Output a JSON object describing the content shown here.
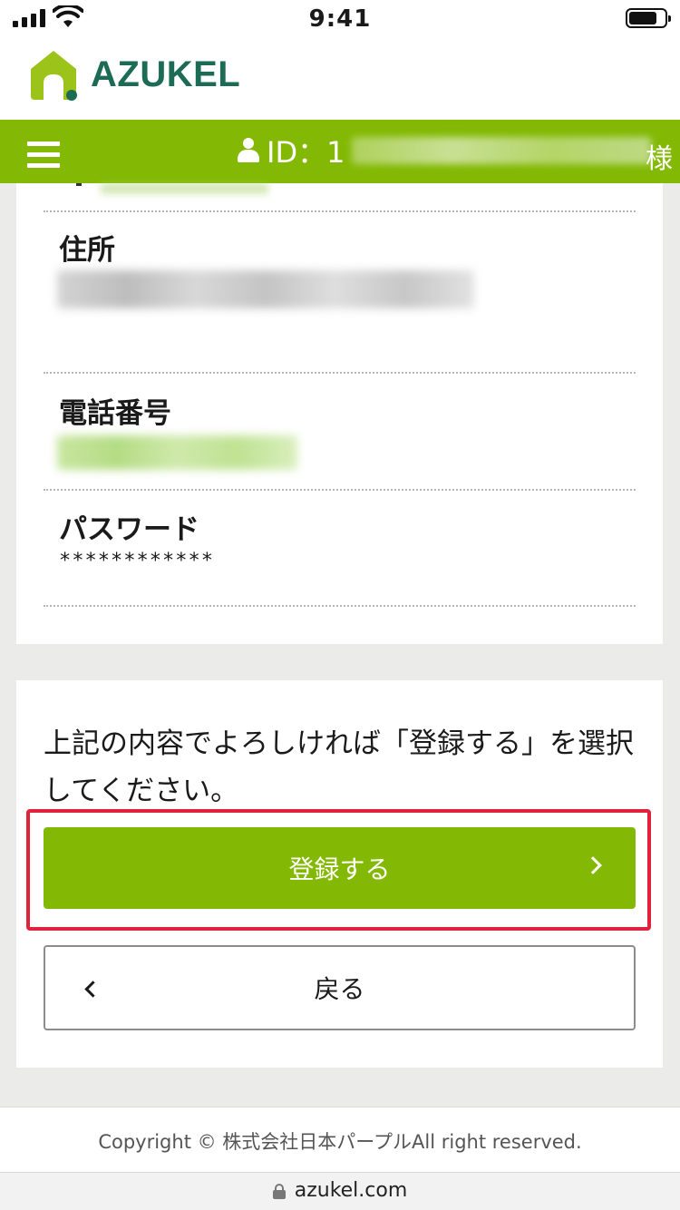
{
  "status_bar": {
    "time": "9:41"
  },
  "header": {
    "brand": "AZUKEL"
  },
  "nav": {
    "id_prefix": "ID：1",
    "honorific": "様"
  },
  "fields": [
    {
      "label": "住所",
      "value_visible": false
    },
    {
      "label": "電話番号",
      "value_visible": false
    },
    {
      "label": "パスワード",
      "value": "************"
    }
  ],
  "confirm": {
    "instruction": "上記の内容でよろしければ「登録する」を選択してください。",
    "register_label": "登録する",
    "back_label": "戻る"
  },
  "footer": {
    "copyright": "Copyright © 株式会社日本パープルAll right reserved."
  },
  "browser": {
    "url": "azukel.com"
  },
  "colors": {
    "brand_green": "#83b905",
    "logo_text": "#1c6b55",
    "highlight_red": "#e2213c"
  }
}
